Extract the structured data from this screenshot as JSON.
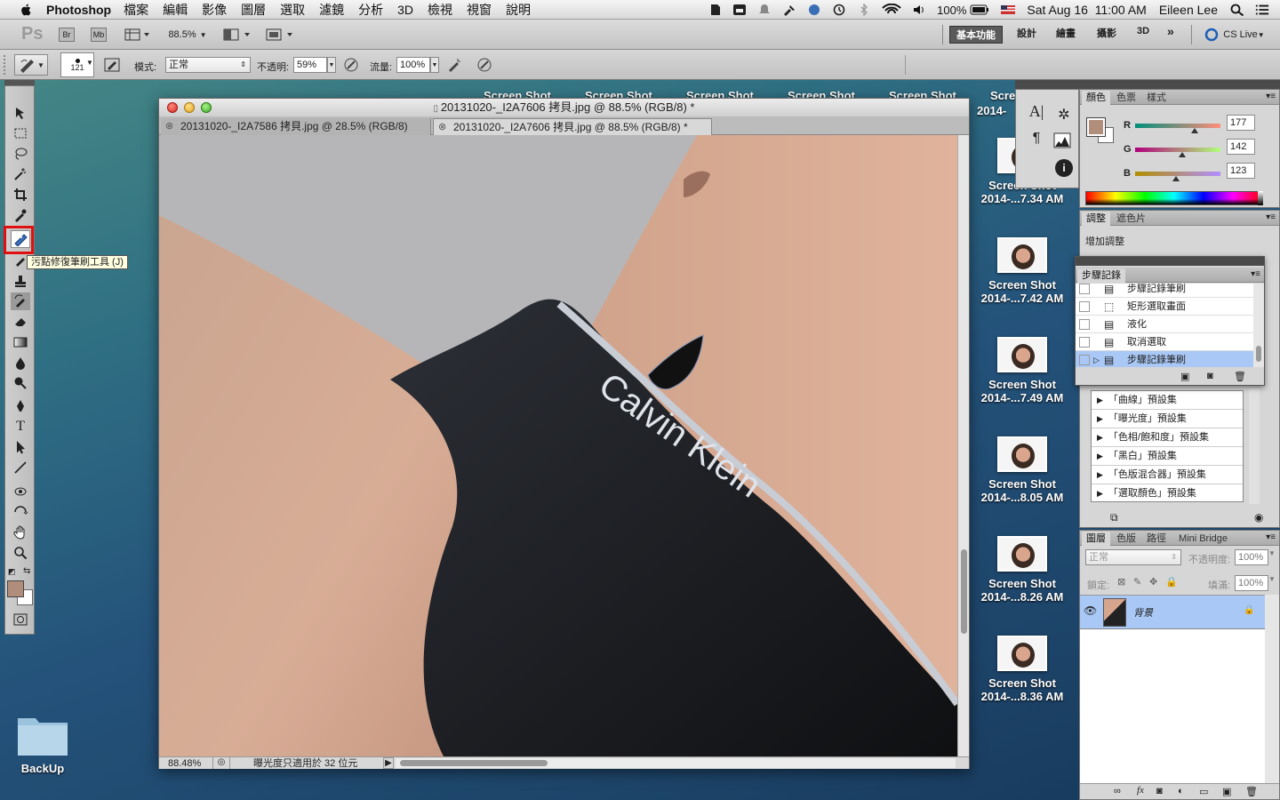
{
  "menubar": {
    "app_name": "Photoshop",
    "menus": [
      "檔案",
      "編輯",
      "影像",
      "圖層",
      "選取",
      "濾鏡",
      "分析",
      "3D",
      "檢視",
      "視窗",
      "說明"
    ],
    "battery": "100%",
    "datetime": "Sat Aug 16  11:00 AM",
    "user": "Eileen Lee"
  },
  "appbar": {
    "logo": "Ps",
    "br": "Br",
    "mb": "Mb",
    "zoom": "88.5%",
    "workspaces": [
      "基本功能",
      "設計",
      "繪畫",
      "攝影",
      "3D"
    ],
    "cs_live": "CS Live"
  },
  "options": {
    "brush_size": "121",
    "mode_label": "模式:",
    "mode_value": "正常",
    "opacity_label": "不透明:",
    "opacity_value": "59%",
    "flow_label": "流量:",
    "flow_value": "100%"
  },
  "tools": {
    "tooltip": "污點修復筆刷工具 (J)"
  },
  "document": {
    "title": "20131020-_I2A7606 拷貝.jpg @ 88.5% (RGB/8) *",
    "tabs": [
      "20131020-_I2A7586 拷貝.jpg @ 28.5% (RGB/8)",
      "20131020-_I2A7606 拷貝.jpg @ 88.5% (RGB/8) *"
    ],
    "status_zoom": "88.48%",
    "status_text": "曝光度只適用於 32 位元",
    "canvas_text": "Calvin Klein"
  },
  "desktop": {
    "top_labels": [
      "Screen Shot",
      "Screen Shot",
      "Screen Shot",
      "Screen Shot",
      "Screen Shot"
    ],
    "partial_label_1": "Scre",
    "partial_label_2": "2014-",
    "screenshots": [
      {
        "name": "Screen Shot",
        "time": "2014-...7.34 AM"
      },
      {
        "name": "Screen Shot",
        "time": "2014-...7.42 AM"
      },
      {
        "name": "Screen Shot",
        "time": "2014-...7.49 AM"
      },
      {
        "name": "Screen Shot",
        "time": "2014-...8.05 AM"
      },
      {
        "name": "Screen Shot",
        "time": "2014-...8.26 AM"
      },
      {
        "name": "Screen Shot",
        "time": "2014-...8.36 AM"
      }
    ],
    "folder": "BackUp"
  },
  "color_panel": {
    "tabs": [
      "顏色",
      "色票",
      "樣式"
    ],
    "r_label": "R",
    "g_label": "G",
    "b_label": "B",
    "r": "177",
    "g": "142",
    "b": "123",
    "r_frac": 0.694,
    "g_frac": 0.557,
    "b_frac": 0.482,
    "fg_color": "#b18e7b"
  },
  "adjust_panel": {
    "tabs": [
      "調整",
      "遮色片"
    ],
    "title": "增加調整",
    "presets": [
      "「曲線」預設集",
      "「曝光度」預設集",
      "「色相/飽和度」預設集",
      "「黑白」預設集",
      "「色版混合器」預設集",
      "「選取顏色」預設集"
    ]
  },
  "history_panel": {
    "tab": "步驟記錄",
    "items": [
      "步驟記錄筆刷",
      "矩形選取畫面",
      "液化",
      "取消選取",
      "步驟記錄筆刷"
    ]
  },
  "layers_panel": {
    "tabs": [
      "圖層",
      "色版",
      "路徑",
      "Mini Bridge"
    ],
    "blend": "正常",
    "opacity_label": "不透明度:",
    "opacity": "100%",
    "lock_label": "鎖定:",
    "fill_label": "填滿:",
    "fill": "100%",
    "layer_name": "背景"
  }
}
